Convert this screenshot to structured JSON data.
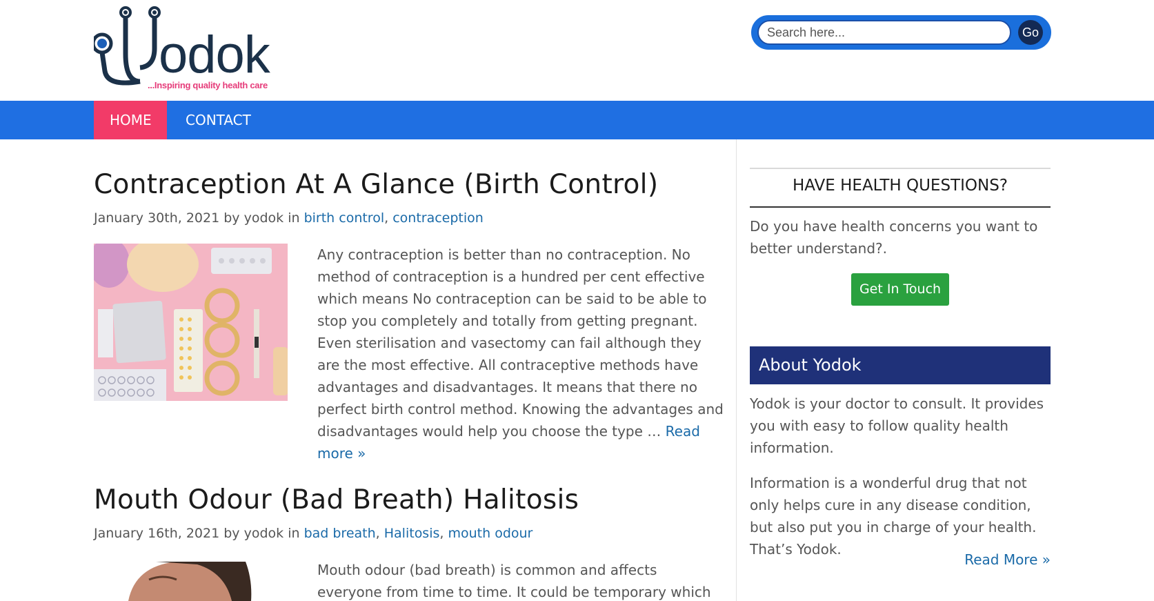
{
  "header": {
    "logo_word": "odok",
    "logo_tagline": "...Inspiring quality health care",
    "search": {
      "placeholder": "Search here...",
      "button": "Go"
    }
  },
  "nav": {
    "items": [
      {
        "label": "HOME",
        "active": true
      },
      {
        "label": "CONTACT",
        "active": false
      }
    ]
  },
  "posts": [
    {
      "title": "Contraception At A Glance (Birth Control)",
      "date": "January 30th, 2021",
      "by": "by",
      "author": "yodok",
      "in": "in",
      "categories": [
        "birth control",
        "contraception"
      ],
      "excerpt": "Any contraception is better than no contraception. No method of contraception is a hundred per cent effective  which means No contraception can be said to be able to stop you completely and totally from getting pregnant. Even sterilisation and vasectomy can fail although they are the most effective. All contraceptive methods have advantages and disadvantages. It means that there no perfect birth control method. Knowing the advantages and disadvantages would help you choose the type …",
      "read_more": "Read more »"
    },
    {
      "title": "Mouth Odour (Bad Breath) Halitosis",
      "date": "January 16th, 2021",
      "by": "by",
      "author": "yodok",
      "in": "in",
      "categories": [
        "bad breath",
        "Halitosis",
        "mouth odour"
      ],
      "excerpt": "Mouth odour (bad breath) is common and affects everyone from time to time. It could be temporary which means when"
    }
  ],
  "sidebar": {
    "questions": {
      "title": "HAVE HEALTH QUESTIONS?",
      "text": "Do you have health concerns you want to better understand?.",
      "button": "Get In Touch"
    },
    "about": {
      "title": "About Yodok",
      "p1": "Yodok is your doctor to consult. It provides you with easy to follow quality health information.",
      "p2": "Information is a wonderful drug that not only helps cure in any disease condition, but also put you in charge of your health. That’s Yodok.",
      "read_more": "Read More »"
    }
  },
  "colors": {
    "nav_bg": "#1f6fe2",
    "nav_active": "#f23b68",
    "link": "#1a6aa8",
    "button_green": "#2aa13f",
    "about_head": "#1f3179",
    "logo_dark": "#1b3149",
    "logo_pink": "#e63c7a"
  }
}
